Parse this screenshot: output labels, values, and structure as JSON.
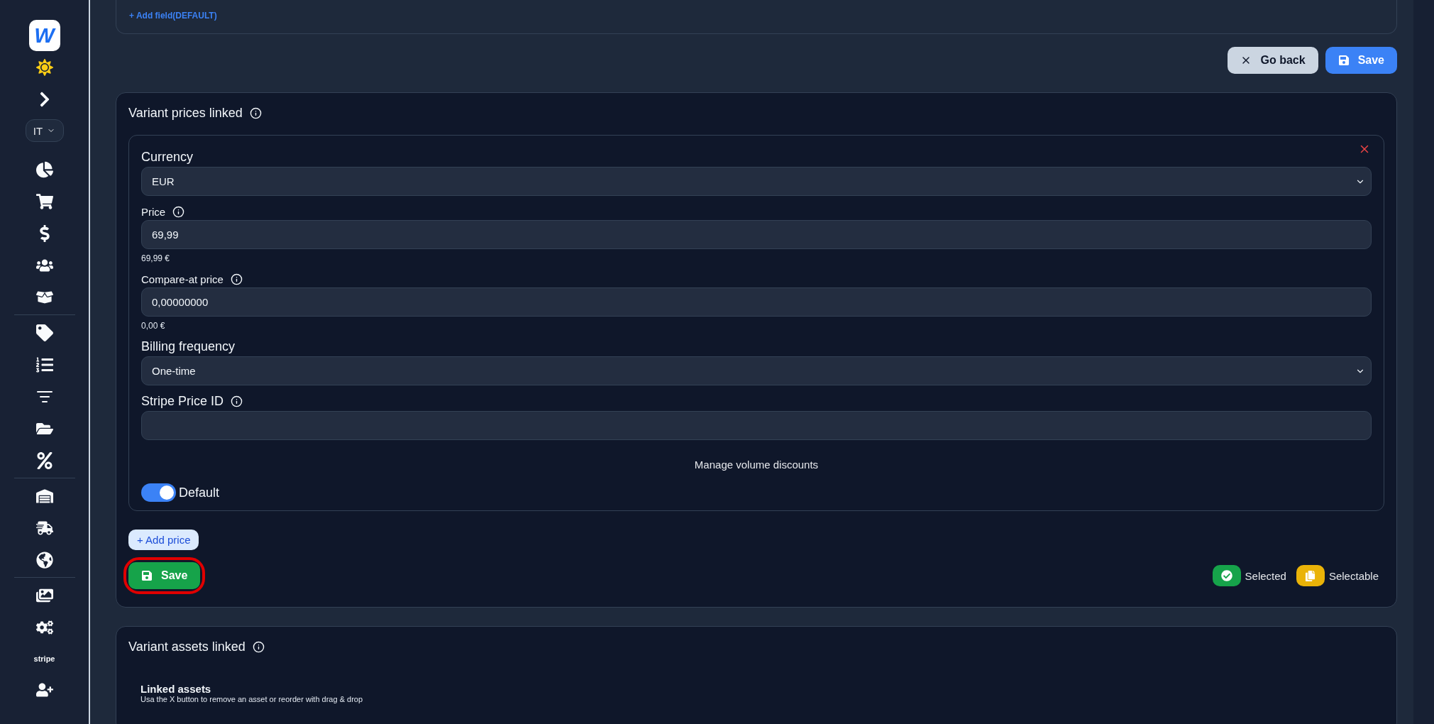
{
  "sidebar": {
    "logo": "W",
    "language": "IT",
    "stripe_label": "stripe"
  },
  "top_card": {
    "add_field_link": "+ Add field(DEFAULT)"
  },
  "actions": {
    "go_back": "Go back",
    "save": "Save"
  },
  "prices_card": {
    "title": "Variant prices linked",
    "price_entry": {
      "currency": {
        "label": "Currency",
        "value": "EUR"
      },
      "price": {
        "label": "Price",
        "value": "69,99",
        "formatted": "69,99 €"
      },
      "compare_at_price": {
        "label": "Compare-at price",
        "value": "0,00000000",
        "formatted": "0,00 €"
      },
      "billing_frequency": {
        "label": "Billing frequency",
        "value": "One-time"
      },
      "stripe_price_id": {
        "label": "Stripe Price ID"
      },
      "volume_discounts_link": "Manage volume discounts",
      "default_toggle": {
        "label": "Default",
        "on": true
      }
    },
    "add_price_button": "+ Add price",
    "save_button": {
      "label": "Save",
      "highlighted": true
    },
    "legend": [
      {
        "kind": "selected",
        "label": "Selected",
        "color": "#16a34a"
      },
      {
        "kind": "selectable",
        "label": "Selectable",
        "color": "#eab308"
      }
    ]
  },
  "assets_card": {
    "title": "Variant assets linked",
    "section_title": "Linked assets",
    "hint": "Usa the X button to remove an asset or reorder with drag & drop"
  }
}
